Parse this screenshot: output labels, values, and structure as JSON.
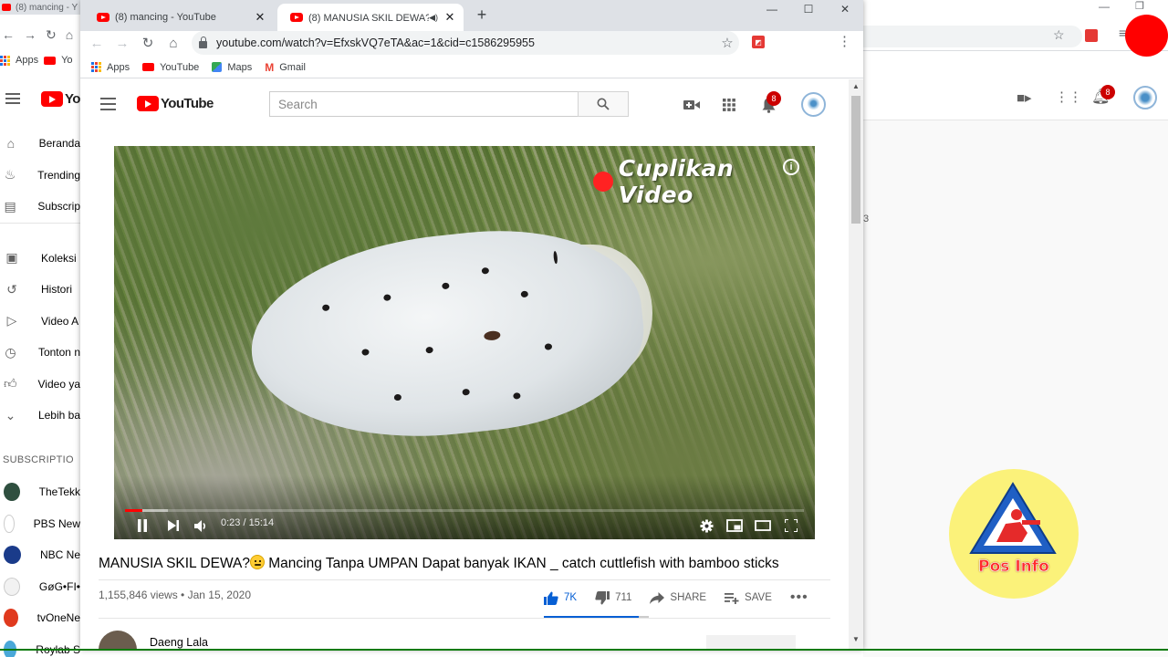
{
  "background_left": {
    "tab_title": "(8) mancing - Y",
    "bookmarks": [
      "Apps",
      "Yo"
    ],
    "sidebar": [
      {
        "label": "Beranda",
        "icon": "home-icon"
      },
      {
        "label": "Trending",
        "icon": "fire-icon"
      },
      {
        "label": "Subscrip",
        "icon": "subscriptions-icon"
      },
      {
        "label": "Koleksi",
        "icon": "library-icon"
      },
      {
        "label": "Histori",
        "icon": "history-icon"
      },
      {
        "label": "Video A",
        "icon": "play-icon"
      },
      {
        "label": "Tonton n",
        "icon": "clock-icon"
      },
      {
        "label": "Video ya",
        "icon": "thumbs-up-icon"
      },
      {
        "label": "Lebih ba",
        "icon": "chevron-down-icon"
      }
    ],
    "subscriptions_title": "SUBSCRIPTIO",
    "subscriptions": [
      {
        "label": "TheTekk",
        "color": "#2f4f3f"
      },
      {
        "label": "PBS New",
        "color": "#ffffff"
      },
      {
        "label": "NBC Ne",
        "color": "#1a3b8a"
      },
      {
        "label": "GøG•FI•",
        "color": "#f2f2f2"
      },
      {
        "label": "tvOneNe",
        "color": "#e03a1e"
      },
      {
        "label": "Roylab S",
        "color": "#4aa8d8"
      }
    ]
  },
  "background_right": {
    "badge": "8",
    "side_text": "3"
  },
  "window": {
    "tabs": [
      {
        "title": "(8) mancing - YouTube",
        "active": false
      },
      {
        "title": "(8) MANUSIA SKIL DEWA?😳",
        "active": true
      }
    ],
    "url": "youtube.com/watch?v=EfxskVQ7eTA&ac=1&cid=c1586295955",
    "bookmarks": [
      "Apps",
      "YouTube",
      "Maps",
      "Gmail"
    ]
  },
  "youtube": {
    "search_placeholder": "Search",
    "notification_count": "8",
    "video": {
      "overlay_label": "Cuplikan Video",
      "time": "0:23 / 15:14",
      "progress_fraction": 0.025,
      "buffer_fraction": 0.063
    },
    "title_part1": "MANUSIA SKIL DEWA?",
    "title_part2": " Mancing Tanpa UMPAN Dapat banyak IKAN _ catch cuttlefish with bamboo sticks",
    "meta": "1,155,846 views • Jan 15, 2020",
    "likes": "7K",
    "dislikes": "711",
    "like_fraction": 0.908,
    "share_label": "SHARE",
    "save_label": "SAVE",
    "channel_name": "Daeng Lala"
  },
  "overlay": {
    "posinfo_label": "Pos Info"
  },
  "colors": {
    "youtube_red": "#ff0000",
    "like_blue": "#065fd4",
    "posinfo_yellow": "#fbf27a"
  }
}
